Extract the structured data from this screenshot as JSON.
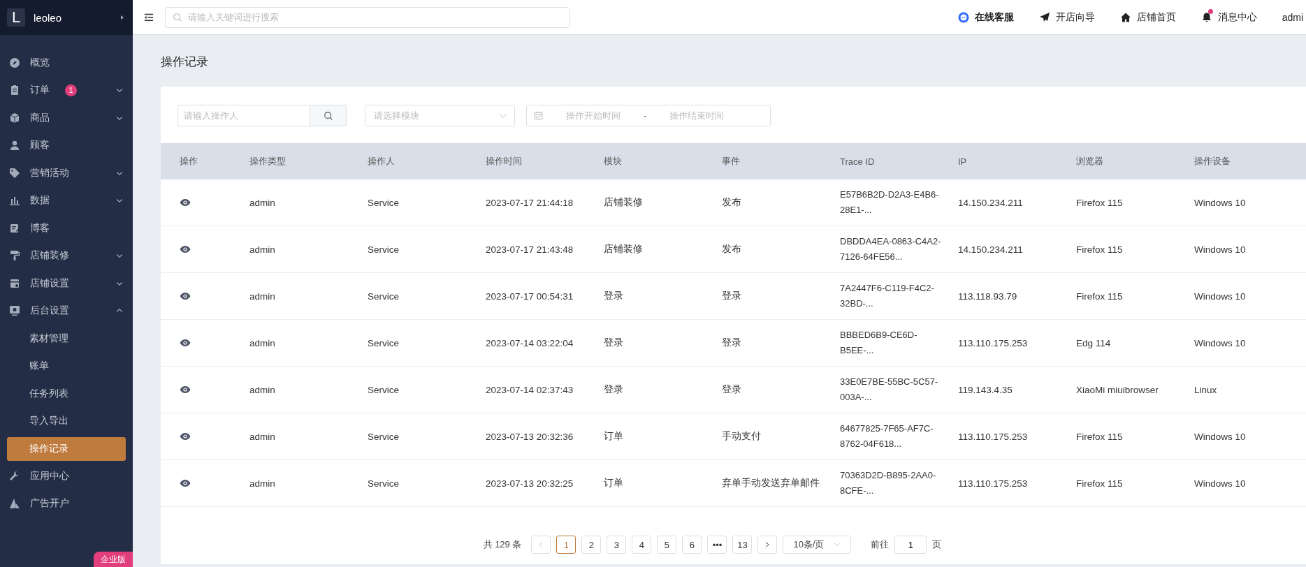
{
  "sidebar": {
    "logo": "L",
    "shop_name": "leoleo",
    "items": [
      {
        "label": "概览"
      },
      {
        "label": "订单",
        "expanded": false,
        "badge": "1"
      },
      {
        "label": "商品",
        "expanded": false
      },
      {
        "label": "顾客"
      },
      {
        "label": "营销活动",
        "expanded": false
      },
      {
        "label": "数据",
        "expanded": false
      },
      {
        "label": "博客"
      },
      {
        "label": "店铺装修",
        "expanded": false
      },
      {
        "label": "店铺设置",
        "expanded": false
      },
      {
        "label": "后台设置",
        "expanded": true,
        "children": [
          {
            "label": "素材管理",
            "selected": false
          },
          {
            "label": "账单",
            "selected": false
          },
          {
            "label": "任务列表",
            "selected": false
          },
          {
            "label": "导入导出",
            "selected": false
          },
          {
            "label": "操作记录",
            "selected": true
          }
        ]
      },
      {
        "label": "应用中心"
      },
      {
        "label": "广告开户"
      }
    ],
    "edition_badge": "企业版"
  },
  "topbar": {
    "search": {
      "placeholder": "请输入关键词进行搜索"
    },
    "links": [
      {
        "kind": "support",
        "label": "在线客服"
      },
      {
        "kind": "guide",
        "label": "开店向导"
      },
      {
        "kind": "home",
        "label": "店铺首页"
      },
      {
        "kind": "messages",
        "label": "消息中心",
        "has_notification": true
      }
    ],
    "user": "admi"
  },
  "page": {
    "title": "操作记录",
    "filters": {
      "operator": {
        "placeholder": "请输入操作人"
      },
      "module": {
        "placeholder": "请选择模块"
      },
      "start_time": {
        "placeholder": "操作开始时间"
      },
      "separator": "-",
      "end_time": {
        "placeholder": "操作结束时间"
      }
    },
    "table": {
      "columns": [
        "操作",
        "操作类型",
        "操作人",
        "操作时间",
        "模块",
        "事件",
        "Trace ID",
        "IP",
        "浏览器",
        "操作设备"
      ],
      "rows": [
        [
          "",
          "admin",
          "Service",
          "2023-07-17 21:44:18",
          "店铺装修",
          "发布",
          "E57B6B2D-D2A3-E4B6-28E1-...",
          "14.150.234.211",
          "Firefox 115",
          "Windows 10"
        ],
        [
          "",
          "admin",
          "Service",
          "2023-07-17 21:43:48",
          "店铺装修",
          "发布",
          "DBDDA4EA-0863-C4A2-7126-64FE56...",
          "14.150.234.211",
          "Firefox 115",
          "Windows 10"
        ],
        [
          "",
          "admin",
          "Service",
          "2023-07-17 00:54:31",
          "登录",
          "登录",
          "7A2447F6-C119-F4C2-32BD-...",
          "113.118.93.79",
          "Firefox 115",
          "Windows 10"
        ],
        [
          "",
          "admin",
          "Service",
          "2023-07-14 03:22:04",
          "登录",
          "登录",
          "BBBED6B9-CE6D-B5EE-...",
          "113.110.175.253",
          "Edg 114",
          "Windows 10"
        ],
        [
          "",
          "admin",
          "Service",
          "2023-07-14 02:37:43",
          "登录",
          "登录",
          "33E0E7BE-55BC-5C57-003A-...",
          "119.143.4.35",
          "XiaoMi miuibrowser",
          "Linux"
        ],
        [
          "",
          "admin",
          "Service",
          "2023-07-13 20:32:36",
          "订单",
          "手动支付",
          "64677825-7F65-AF7C-8762-04F618...",
          "113.110.175.253",
          "Firefox 115",
          "Windows 10"
        ],
        [
          "",
          "admin",
          "Service",
          "2023-07-13 20:32:25",
          "订单",
          "弃单手动发送弃单邮件",
          "70363D2D-B895-2AA0-8CFE-...",
          "113.110.175.253",
          "Firefox 115",
          "Windows 10"
        ]
      ]
    },
    "pagination": {
      "total": "共 129 条",
      "prev_disabled": true,
      "next_disabled": false,
      "pages": [
        {
          "label": "1",
          "selected": true
        },
        {
          "label": "2",
          "selected": false
        },
        {
          "label": "3",
          "selected": false
        },
        {
          "label": "4",
          "selected": false
        },
        {
          "label": "5",
          "selected": false
        },
        {
          "label": "6",
          "selected": false
        },
        {
          "label": "•••",
          "selected": false
        },
        {
          "label": "13",
          "selected": false
        }
      ],
      "page_size": "10条/页",
      "goto_label": "前往",
      "goto_value": "1",
      "page_unit": "页"
    }
  }
}
